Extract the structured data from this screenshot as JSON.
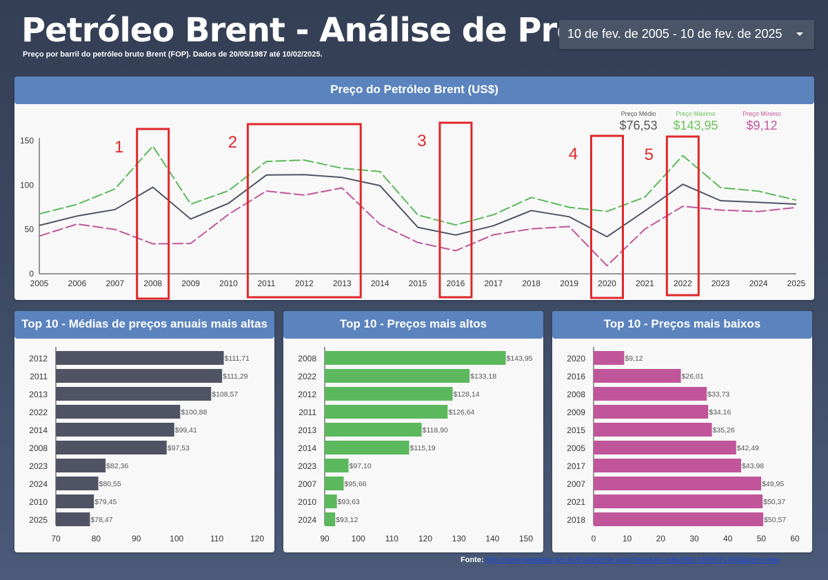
{
  "header": {
    "title": "Petróleo Brent - Análise de Preço",
    "subtitle": "Preço por barril do petróleo bruto Brent (FOP). Dados de 20/05/1987 até 10/02/2025.",
    "date_range": "10 de fev. de 2005 - 10 de fev. de 2025"
  },
  "line_panel": {
    "title": "Preço do Petróleo Brent (US$)",
    "kpis": [
      {
        "label": "Preço Médio",
        "value": "$76,53",
        "color": "#555555"
      },
      {
        "label": "Preço Máximo",
        "value": "$143,95",
        "color": "#6cc35a"
      },
      {
        "label": "Preço Mínimo",
        "value": "$9,12",
        "color": "#c2549a"
      }
    ],
    "annotations": [
      {
        "number": "1",
        "years": [
          "2008"
        ]
      },
      {
        "number": "2",
        "years": [
          "2011",
          "2012",
          "2013"
        ]
      },
      {
        "number": "3",
        "years": [
          "2016"
        ]
      },
      {
        "number": "4",
        "years": [
          "2020"
        ]
      },
      {
        "number": "5",
        "years": [
          "2022"
        ]
      }
    ]
  },
  "bar_panels": {
    "avg_title": "Top 10 - Médias de preços anuais mais altas",
    "max_title": "Top 10 - Preços mais altos",
    "min_title": "Top 10 - Preços mais baixos"
  },
  "footer": {
    "source_label": "Fonte:",
    "source_link": "http://www.ipeadata.gov.br/ExibeSerie.aspx?module=m&serid=1650971490&oper=view"
  },
  "colors": {
    "average": "#4f5363",
    "maximum": "#5cb85c",
    "minimum": "#c0559a",
    "annotation_box": "#e0262a",
    "header_bar": "#5b84bf"
  },
  "chart_data": [
    {
      "type": "line",
      "title": "Preço do Petróleo Brent (US$)",
      "x": [
        "2005",
        "2006",
        "2007",
        "2008",
        "2009",
        "2010",
        "2011",
        "2012",
        "2013",
        "2014",
        "2015",
        "2016",
        "2017",
        "2018",
        "2019",
        "2020",
        "2021",
        "2022",
        "2023",
        "2024",
        "2025"
      ],
      "yticks": [
        0,
        50,
        100,
        150
      ],
      "ylim": [
        0,
        150
      ],
      "series": [
        {
          "name": "Preço Máximo",
          "color": "#5cb85c",
          "dash": "dashed",
          "values": [
            67.5,
            78.3,
            95.66,
            143.95,
            78.5,
            93.63,
            126.64,
            128.14,
            118.9,
            115.19,
            66.3,
            55.0,
            66.5,
            86.0,
            74.9,
            70.3,
            86.4,
            133.18,
            97.1,
            93.12,
            83.0
          ]
        },
        {
          "name": "Preço Médio",
          "color": "#4f5363",
          "dash": "solid",
          "values": [
            54.5,
            65.1,
            72.4,
            97.53,
            61.7,
            79.45,
            111.29,
            111.71,
            108.57,
            99.41,
            52.4,
            43.7,
            54.2,
            71.3,
            64.3,
            41.8,
            70.9,
            100.88,
            82.36,
            80.55,
            78.47
          ]
        },
        {
          "name": "Preço Mínimo",
          "color": "#c0559a",
          "dash": "dashed",
          "values": [
            42.49,
            56.0,
            49.95,
            33.73,
            34.16,
            67.0,
            93.3,
            88.7,
            96.8,
            55.8,
            35.26,
            26.01,
            43.98,
            50.57,
            53.2,
            9.12,
            50.37,
            76.1,
            71.8,
            70.2,
            74.8
          ]
        }
      ]
    },
    {
      "type": "bar",
      "orientation": "horizontal",
      "title": "Top 10 - Médias de preços anuais mais altas",
      "categories": [
        "2012",
        "2011",
        "2013",
        "2022",
        "2014",
        "2008",
        "2023",
        "2024",
        "2010",
        "2025"
      ],
      "values": [
        111.71,
        111.29,
        108.57,
        100.88,
        99.41,
        97.53,
        82.36,
        80.55,
        79.45,
        78.47
      ],
      "value_labels": [
        "$111,71",
        "$111,29",
        "$108,57",
        "$100,88",
        "$99,41",
        "$97,53",
        "$82,36",
        "$80,55",
        "$79,45",
        "$78,47"
      ],
      "xlim": [
        70,
        120
      ],
      "xticks": [
        70,
        80,
        90,
        100,
        110,
        120
      ],
      "color": "#4f5363"
    },
    {
      "type": "bar",
      "orientation": "horizontal",
      "title": "Top 10 - Preços mais altos",
      "categories": [
        "2008",
        "2022",
        "2012",
        "2011",
        "2013",
        "2014",
        "2023",
        "2007",
        "2010",
        "2024"
      ],
      "values": [
        143.95,
        133.18,
        128.14,
        126.64,
        118.9,
        115.19,
        97.1,
        95.66,
        93.63,
        93.12
      ],
      "value_labels": [
        "$143,95",
        "$133,18",
        "$128,14",
        "$126,64",
        "$118,90",
        "$115,19",
        "$97,10",
        "$95,66",
        "$93,63",
        "$93,12"
      ],
      "xlim": [
        90,
        150
      ],
      "xticks": [
        90,
        100,
        110,
        120,
        130,
        140,
        150
      ],
      "color": "#5cb85c"
    },
    {
      "type": "bar",
      "orientation": "horizontal",
      "title": "Top 10 - Preços mais baixos",
      "categories": [
        "2020",
        "2016",
        "2008",
        "2009",
        "2015",
        "2005",
        "2017",
        "2007",
        "2021",
        "2018"
      ],
      "values": [
        9.12,
        26.01,
        33.73,
        34.16,
        35.26,
        42.49,
        43.98,
        49.95,
        50.37,
        50.57
      ],
      "value_labels": [
        "$9,12",
        "$26,01",
        "$33,73",
        "$34,16",
        "$35,26",
        "$42,49",
        "$43,98",
        "$49,95",
        "$50,37",
        "$50,57"
      ],
      "xlim": [
        0,
        60
      ],
      "xticks": [
        0,
        10,
        20,
        30,
        40,
        50,
        60
      ],
      "color": "#c0559a"
    }
  ]
}
